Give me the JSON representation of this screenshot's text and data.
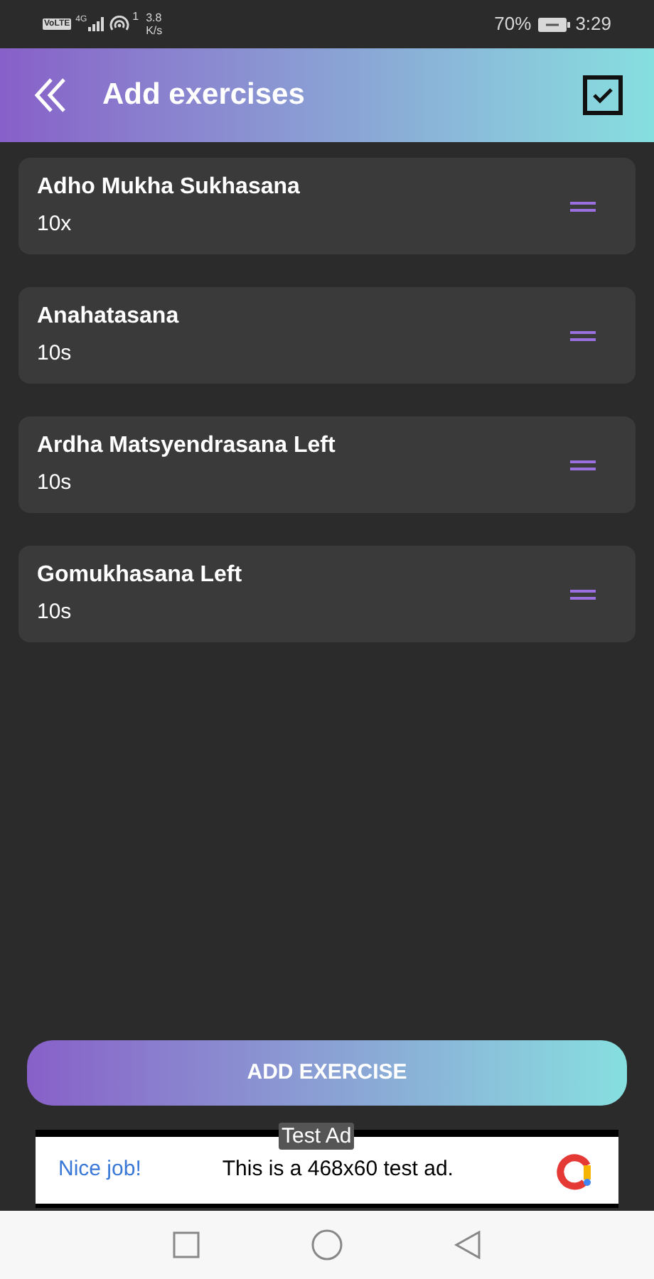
{
  "status_bar": {
    "volte": "VoLTE",
    "network": "4G",
    "notification_count": "1",
    "speed": "3.8",
    "speed_unit": "K/s",
    "battery": "70%",
    "time": "3:29"
  },
  "header": {
    "title": "Add exercises"
  },
  "exercises": [
    {
      "name": "Adho Mukha Sukhasana",
      "amount": "10x"
    },
    {
      "name": "Anahatasana",
      "amount": "10s"
    },
    {
      "name": "Ardha Matsyendrasana Left",
      "amount": "10s"
    },
    {
      "name": "Gomukhasana Left",
      "amount": "10s"
    }
  ],
  "add_button": {
    "label": "ADD EXERCISE"
  },
  "ad": {
    "badge": "Test Ad",
    "headline": "Nice job!",
    "text": "This is a 468x60 test ad."
  }
}
